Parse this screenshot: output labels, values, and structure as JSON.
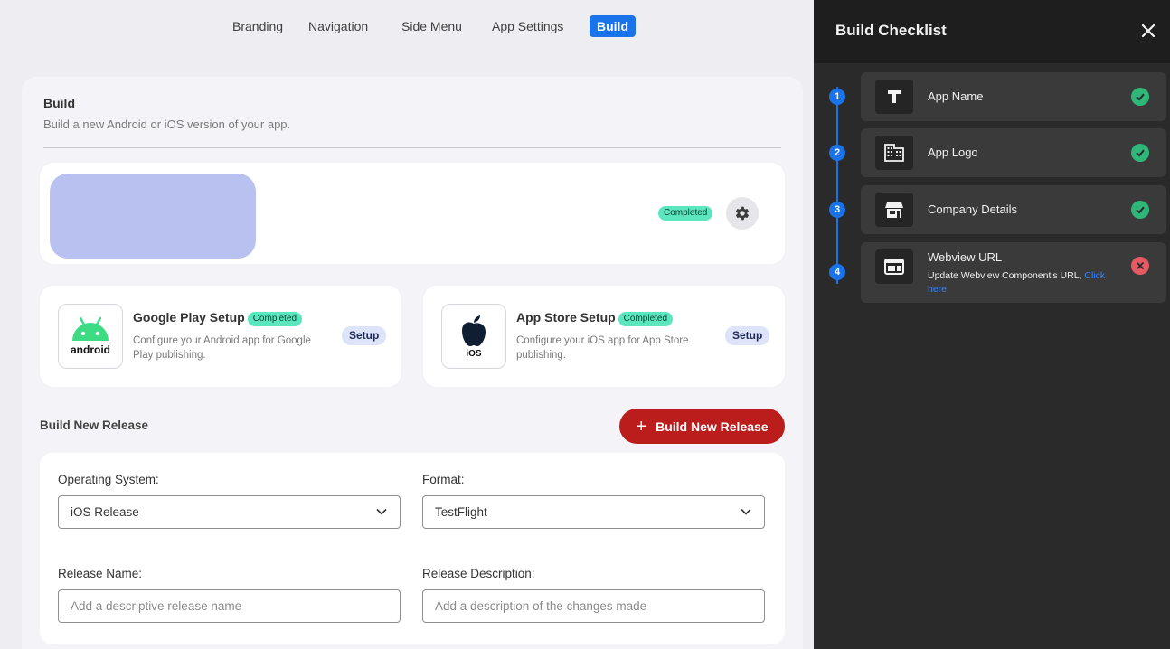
{
  "nav": {
    "tabs": [
      {
        "label": "Branding",
        "active": false
      },
      {
        "label": "Navigation",
        "active": false
      },
      {
        "label": "Side Menu",
        "active": false
      },
      {
        "label": "App Settings",
        "active": false
      },
      {
        "label": "Build",
        "active": true
      }
    ]
  },
  "build": {
    "title": "Build",
    "subtitle": "Build a new Android or iOS version of your app."
  },
  "app_card": {
    "status_badge": "Completed"
  },
  "google_play": {
    "title": "Google Play Setup",
    "badge": "Completed",
    "description": "Configure your Android app for Google Play publishing.",
    "button": "Setup",
    "logo_text": "android"
  },
  "app_store": {
    "title": "App Store Setup",
    "badge": "Completed",
    "description": "Configure your iOS app for App Store publishing.",
    "button": "Setup",
    "logo_text": "iOS"
  },
  "release": {
    "title": "Build New Release",
    "button": "Build New Release",
    "os_label": "Operating System:",
    "os_value": "iOS Release",
    "format_label": "Format:",
    "format_value": "TestFlight",
    "name_label": "Release Name:",
    "name_placeholder": "Add a descriptive release name",
    "desc_label": "Release Description:",
    "desc_placeholder": "Add a description of the changes made"
  },
  "checklist": {
    "title": "Build Checklist",
    "items": [
      {
        "num": "1",
        "label": "App Name",
        "icon": "text-icon",
        "status": "complete"
      },
      {
        "num": "2",
        "label": "App Logo",
        "icon": "building-icon",
        "status": "complete"
      },
      {
        "num": "3",
        "label": "Company Details",
        "icon": "store-icon",
        "status": "complete"
      },
      {
        "num": "4",
        "label": "Webview URL",
        "icon": "webview-icon",
        "status": "incomplete",
        "description": "Update Webview Component's URL,",
        "link": "Click here"
      }
    ]
  },
  "colors": {
    "accent": "#1a73e8",
    "release_button": "#bb1c1c",
    "badge": "#5ce6bf",
    "panel_bg": "#2a2a2b",
    "success": "#2fb77a",
    "error": "#e55a63",
    "android_green": "#3ddc84"
  }
}
